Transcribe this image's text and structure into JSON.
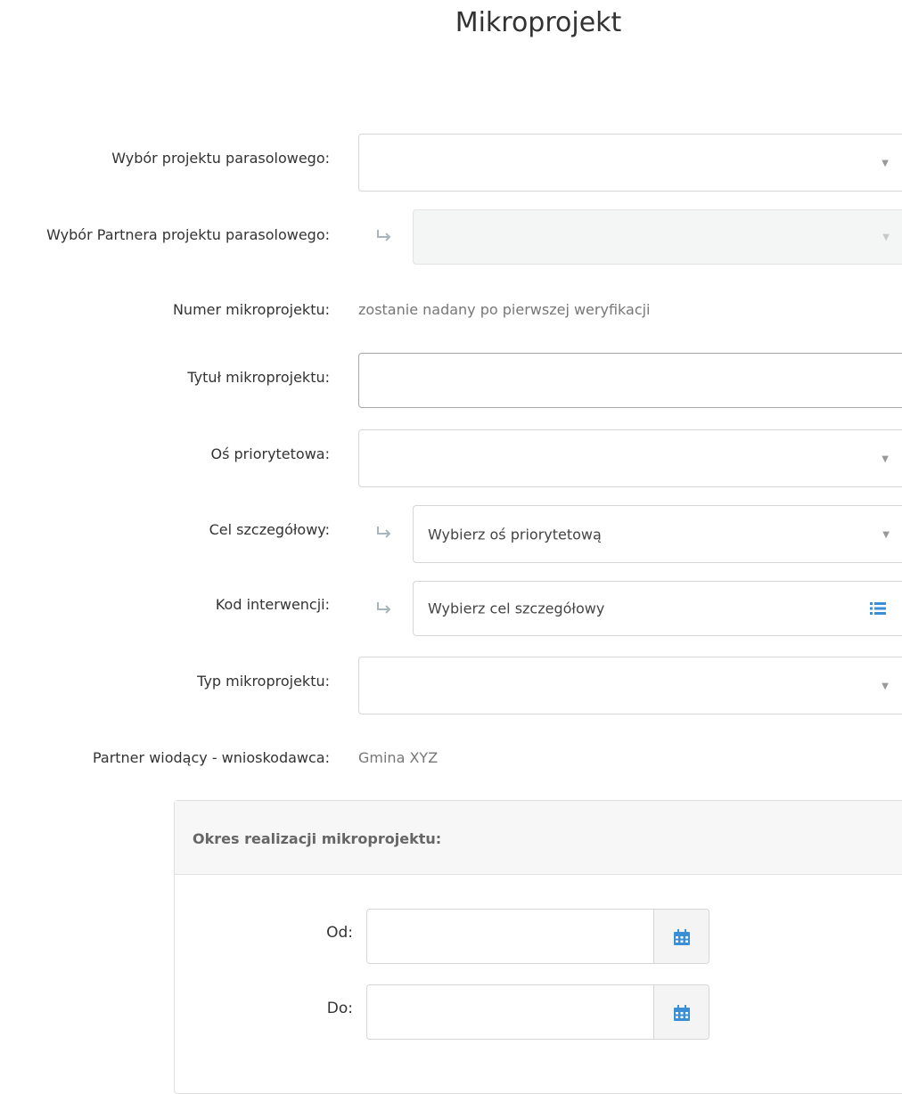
{
  "page": {
    "title": "Mikroprojekt"
  },
  "form": {
    "umbrella_project": {
      "label": "Wybór projektu parasolowego:",
      "value": ""
    },
    "umbrella_partner": {
      "label": "Wybór Partnera projektu parasolowego:",
      "value": ""
    },
    "micro_number": {
      "label": "Numer mikroprojektu:",
      "value": "zostanie nadany po pierwszej weryfikacji"
    },
    "micro_title": {
      "label": "Tytuł mikroprojektu:",
      "value": ""
    },
    "priority_axis": {
      "label": "Oś priorytetowa:",
      "value": ""
    },
    "specific_goal": {
      "label": "Cel szczegółowy:",
      "value": "Wybierz oś priorytetową"
    },
    "intervention_code": {
      "label": "Kod interwencji:",
      "value": "Wybierz cel szczegółowy"
    },
    "micro_type": {
      "label": "Typ mikroprojektu:",
      "value": ""
    },
    "lead_partner": {
      "label": "Partner wiodący - wnioskodawca:",
      "value": "Gmina XYZ"
    }
  },
  "period": {
    "title": "Okres realizacji mikroprojektu:",
    "from_label": "Od:",
    "to_label": "Do:",
    "from_value": "",
    "to_value": ""
  },
  "icons": {
    "caret": "caret-down-icon",
    "dependency": "sub-arrow-icon",
    "list": "list-icon",
    "calendar": "calendar-icon"
  },
  "colors": {
    "accent": "#3a8fd6",
    "border": "#d6d6d6",
    "disabled_bg": "#f4f5f5"
  }
}
